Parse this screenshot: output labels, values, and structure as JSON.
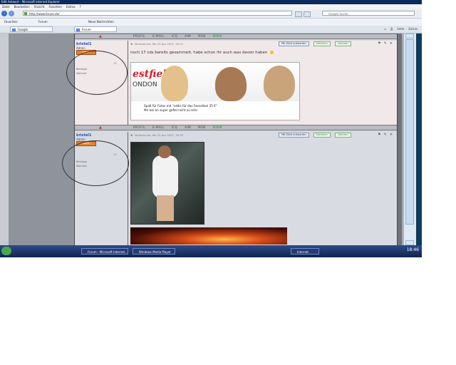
{
  "browser": {
    "title": "Edit Antwort - Microsoft Internet Explorer",
    "menu": [
      "Datei",
      "Bearbeiten",
      "Ansicht",
      "Favoriten",
      "Extras",
      "?"
    ],
    "address": "http://www.forum.de/",
    "search_placeholder": "Google Suche",
    "favorites": [
      "Favoriten",
      "Forum",
      "Neue Nachrichten"
    ],
    "tabs": [
      {
        "label": "Google",
        "active": false
      },
      {
        "label": "Forum",
        "active": true
      }
    ],
    "tool_labels": [
      "Seite",
      "Extras"
    ]
  },
  "forum": {
    "bar_buttons": [
      "PROFIL",
      "E-MAIL",
      "ICQ",
      "AIM",
      "MSN",
      "WWW"
    ],
    "posts": [
      {
        "username": "kristel1",
        "role": "Admin",
        "badge": "Admin",
        "stat1": "Beiträge",
        "stat2": "Wohnort",
        "count": "12",
        "meta": "Verfasst am: Mo 23 Apr 2007, 20:47",
        "actions": [
          "Mit Zitat antworten",
          "Editieren",
          "Löschen"
        ],
        "text": "noch 17 cds bereits gesammelt, habe schon ihr auch was davon haben",
        "photo_wordmark": "estfield",
        "photo_city": "ONDON",
        "caption_line1": "Spaß für Fotos mit \"cddis für das Fanartikel 25 €\"",
        "caption_line2": "Mir bei en super gefiel nicht zu sehr"
      },
      {
        "username": "kristel1",
        "role": "Admin",
        "badge": "Admin",
        "stat1": "Beiträge",
        "stat2": "Wohnort",
        "count": "12",
        "meta": "Verfasst am: Mo 23 Apr 2007, 20:52",
        "actions": [
          "Mit Zitat antworten",
          "Editieren",
          "Löschen"
        ],
        "text": ""
      }
    ]
  },
  "taskbar": {
    "items": [
      "Forum - Microsoft Internet...",
      "Windows Media Player",
      "Internet"
    ],
    "clock": "18:46"
  }
}
